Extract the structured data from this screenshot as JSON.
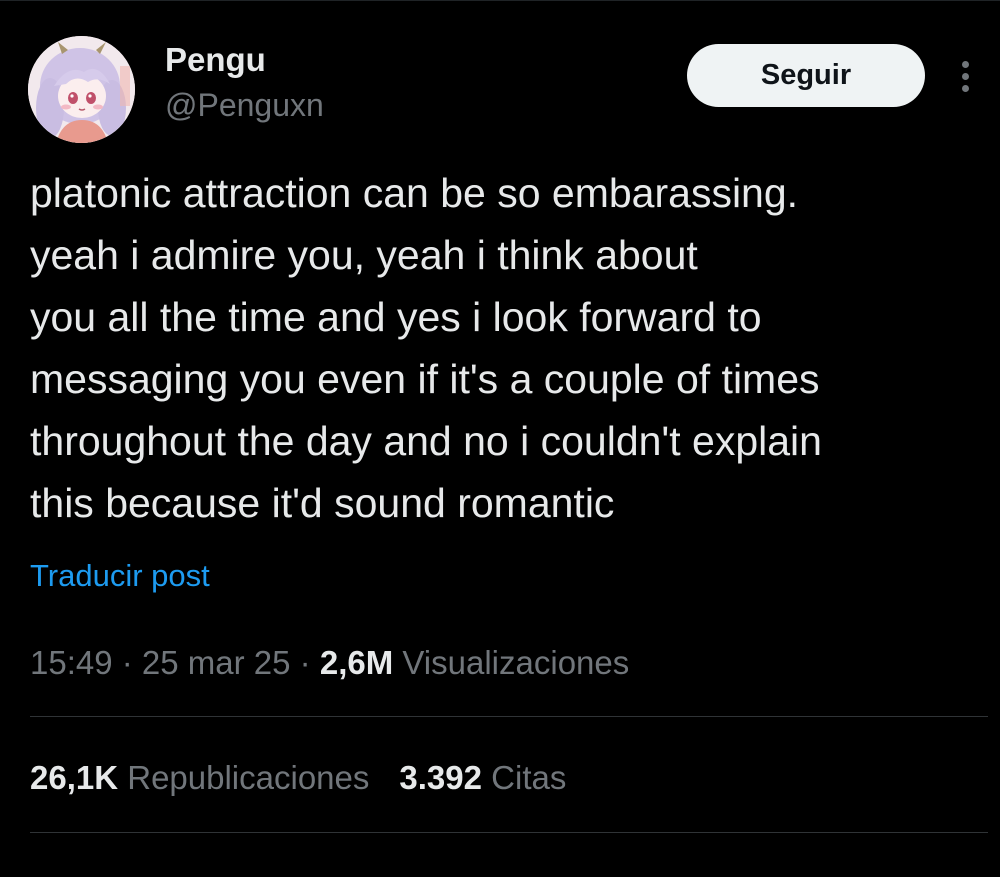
{
  "author": {
    "display_name": "Pengu",
    "handle": "@Penguxn"
  },
  "actions": {
    "follow_label": "Seguir",
    "more_icon": "more-vertical-icon"
  },
  "post": {
    "text": "platonic attraction can be so embarassing.\nyeah i admire you, yeah i think about\nyou all the time and yes i look forward to\nmessaging you even if it's a couple of times\nthroughout the day and no i couldn't explain\nthis because it'd sound romantic",
    "translate_label": "Traducir post"
  },
  "meta": {
    "time": "15:49",
    "separator": " · ",
    "date": "25 mar 25",
    "views_count": "2,6M",
    "views_label": "Visualizaciones"
  },
  "stats": {
    "reposts_count": "26,1K",
    "reposts_label": "Republicaciones",
    "quotes_count": "3.392",
    "quotes_label": "Citas"
  },
  "colors": {
    "background": "#000000",
    "primary_text": "#e7e9ea",
    "secondary_text": "#71767b",
    "link": "#1d9bf0",
    "follow_bg": "#eff3f4",
    "divider": "#2f3336"
  }
}
